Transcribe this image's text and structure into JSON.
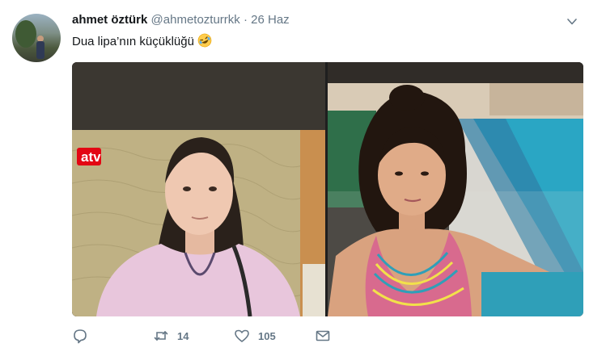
{
  "tweet": {
    "author_name": "ahmet öztürk",
    "handle": "@ahmetozturrkk",
    "separator": "·",
    "date": "26 Haz",
    "text": "Dua lipa’nın küçüklüğü",
    "emoji": "rolling-on-floor-laughing"
  },
  "media": {
    "left_image": {
      "overlay_logo": "atv"
    },
    "right_image": {}
  },
  "actions": {
    "reply_count": "",
    "retweet_count": "14",
    "like_count": "105"
  },
  "colors": {
    "text": "#14171a",
    "secondary": "#657786",
    "atv_logo": "#e30613"
  }
}
